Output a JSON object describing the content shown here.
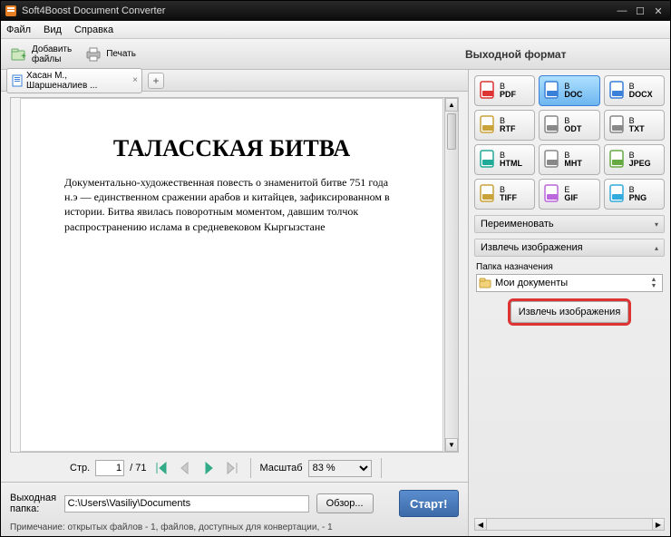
{
  "title": "Soft4Boost Document Converter",
  "menu": {
    "file": "Файл",
    "view": "Вид",
    "help": "Справка"
  },
  "toolbar": {
    "add_files_l1": "Добавить",
    "add_files_l2": "файлы",
    "print": "Печать",
    "output_format_header": "Выходной формат"
  },
  "tab": {
    "label": "Хасан М., Шаршеналиев ..."
  },
  "document": {
    "heading": "ТАЛАССКАЯ БИТВА",
    "paragraph": "Документально-художественная повесть о знаменитой битве 751 года н.э — единственном сражении арабов и китайцев, зафиксированном в истории. Битва явилась поворотным моментом, давшим толчок распространению ислама в средневековом Кыргызстане"
  },
  "nav": {
    "page_label": "Стр.",
    "page_current": "1",
    "page_total": "/ 71",
    "zoom_label": "Масштаб",
    "zoom_value": "83 %"
  },
  "footer": {
    "output_label": "Выходная папка:",
    "output_path": "C:\\Users\\Vasiliy\\Documents",
    "browse": "Обзор...",
    "start": "Старт!",
    "note": "Примечание: открытых файлов - 1, файлов, доступных для конвертации, - 1"
  },
  "formats": [
    {
      "prefix": "В",
      "name": "PDF",
      "icon": "pdf"
    },
    {
      "prefix": "В",
      "name": "DOC",
      "icon": "doc",
      "selected": true
    },
    {
      "prefix": "В",
      "name": "DOCX",
      "icon": "docx"
    },
    {
      "prefix": "В",
      "name": "RTF",
      "icon": "rtf"
    },
    {
      "prefix": "В",
      "name": "ODT",
      "icon": "odt"
    },
    {
      "prefix": "В",
      "name": "TXT",
      "icon": "txt"
    },
    {
      "prefix": "В",
      "name": "HTML",
      "icon": "html"
    },
    {
      "prefix": "В",
      "name": "MHT",
      "icon": "mht"
    },
    {
      "prefix": "В",
      "name": "JPEG",
      "icon": "jpeg"
    },
    {
      "prefix": "В",
      "name": "TIFF",
      "icon": "tiff"
    },
    {
      "prefix": "Е",
      "name": "GIF",
      "icon": "gif"
    },
    {
      "prefix": "В",
      "name": "PNG",
      "icon": "png"
    }
  ],
  "panels": {
    "rename": "Переименовать",
    "extract": "Извлечь изображения",
    "dest_label": "Папка назначения",
    "dest_value": "Мои документы",
    "extract_btn": "Извлечь изображения"
  }
}
